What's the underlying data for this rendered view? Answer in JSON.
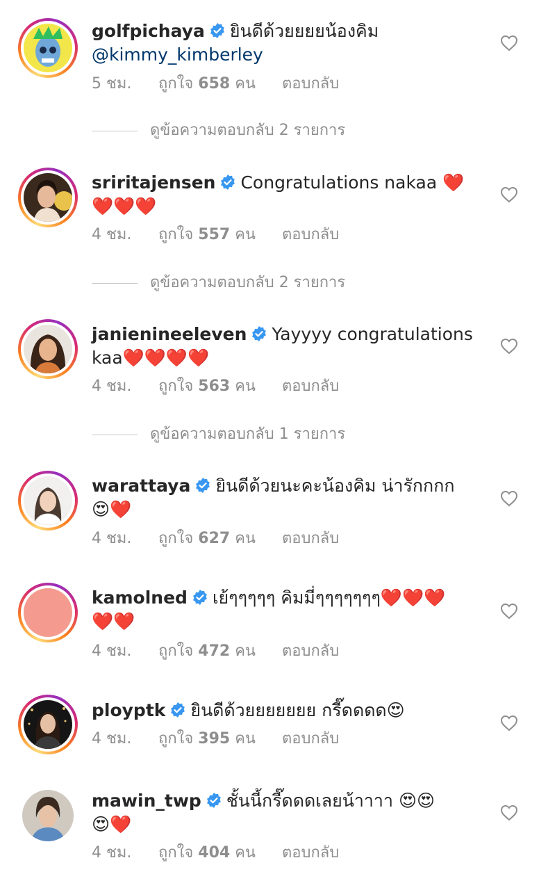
{
  "comments": [
    {
      "username": "golfpichaya",
      "line1": "ยินดีด้วยยยยน้องคิม",
      "line2_mention": "@kimmy_kimberley",
      "time": "5 ชม.",
      "likes_prefix": "ถูกใจ",
      "likes_count": "658",
      "likes_suffix": "คน",
      "reply": "ตอบกลับ",
      "view_replies": "ดูข้อความตอบกลับ 2 รายการ"
    },
    {
      "username": "sriritajensen",
      "line1": "Congratulations nakaa ❤️",
      "line2": "❤️❤️❤️",
      "time": "4 ชม.",
      "likes_prefix": "ถูกใจ",
      "likes_count": "557",
      "likes_suffix": "คน",
      "reply": "ตอบกลับ",
      "view_replies": "ดูข้อความตอบกลับ 2 รายการ"
    },
    {
      "username": "janienineeleven",
      "line1": "Yayyyy congratulations",
      "line2": "kaa❤️❤️❤️❤️",
      "time": "4 ชม.",
      "likes_prefix": "ถูกใจ",
      "likes_count": "563",
      "likes_suffix": "คน",
      "reply": "ตอบกลับ",
      "view_replies": "ดูข้อความตอบกลับ 1 รายการ"
    },
    {
      "username": "warattaya",
      "line1": "ยินดีด้วยนะคะน้องคิม น่ารักกกก",
      "line2": "😍❤️",
      "time": "4 ชม.",
      "likes_prefix": "ถูกใจ",
      "likes_count": "627",
      "likes_suffix": "คน",
      "reply": "ตอบกลับ"
    },
    {
      "username": "kamolned",
      "line1": "เย้ๆๆๆๆๆ คิมมี่ๆๆๆๆๆๆๆ❤️❤️❤️",
      "line2": "❤️❤️",
      "time": "4 ชม.",
      "likes_prefix": "ถูกใจ",
      "likes_count": "472",
      "likes_suffix": "คน",
      "reply": "ตอบกลับ"
    },
    {
      "username": "ploypt",
      "username_display": "ployptk",
      "line1": "ยินดีด้วยยยยยยย กรี๊ดดดด😍",
      "time": "4 ชม.",
      "likes_prefix": "ถูกใจ",
      "likes_count": "395",
      "likes_suffix": "คน",
      "reply": "ตอบกลับ"
    },
    {
      "username": "mawin_twp",
      "line1": "ชั้นนี้กรี๊ดดดเลยน้าาาา 😍😍",
      "line2": "😍❤️",
      "time": "4 ชม.",
      "likes_prefix": "ถูกใจ",
      "likes_count": "404",
      "likes_suffix": "คน",
      "reply": "ตอบกลับ"
    }
  ],
  "colors": {
    "verified_blue": "#3897f0",
    "mention_blue": "#00376b",
    "muted_gray": "#8e8e8e",
    "heart_red": "#e0245e"
  },
  "icons": {
    "verified": "verified-badge-icon",
    "like": "heart-outline-icon"
  }
}
